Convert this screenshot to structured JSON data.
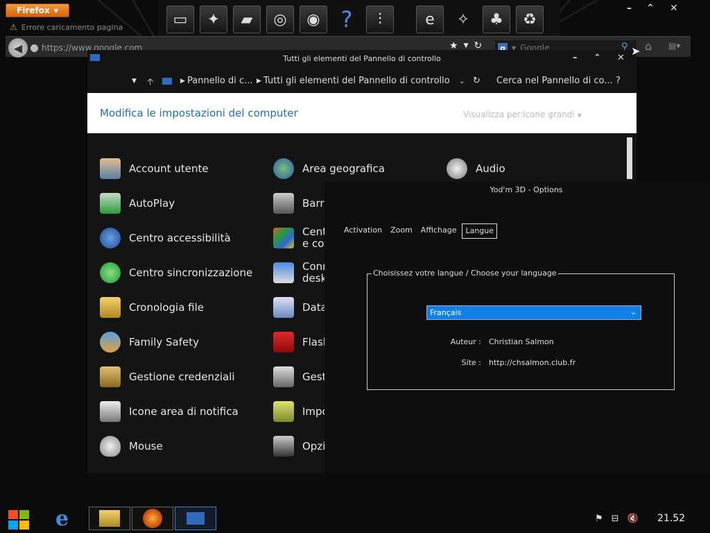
{
  "firefox": {
    "menu_label": "Firefox",
    "tab_title": "Errore caricamento pagina",
    "url": "https://www.google.com",
    "search_engine": "Google",
    "search_placeholder": "Google"
  },
  "control_panel": {
    "window_title": "Tutti gli elementi del Pannello di controllo",
    "breadcrumb": [
      "Pannello di c...",
      "Tutti gli elementi del Pannello di controllo"
    ],
    "search_placeholder": "Cerca nel Pannello di co...",
    "help": "?",
    "header_title": "Modifica le impostazioni del computer",
    "view_label": "Visualizza per:",
    "view_value": "Icone grandi",
    "items_col1": [
      "Account utente",
      "AutoPlay",
      "Centro accessibilità",
      "Centro sincronizzazione",
      "Cronologia file",
      "Family Safety",
      "Gestione credenziali",
      "Icone area di notifica",
      "Mouse"
    ],
    "items_col2": [
      "Area geografica",
      "Barr",
      "Cent\ne co",
      "Conr\ndesk",
      "Data",
      "Flasl",
      "Gest",
      "Impo",
      "Opzi"
    ],
    "items_col3": [
      "Audio"
    ]
  },
  "yodm": {
    "title": "Yod'm 3D - Options",
    "tabs": [
      "Activation",
      "Zoom",
      "Affichage",
      "Langue"
    ],
    "active_tab": "Langue",
    "group_title": "Choisissez votre langue / Choose your language",
    "language": "Français",
    "author_label": "Auteur :",
    "author_value": "Christian Salmon",
    "site_label": "Site :",
    "site_value": "http://chsalmon.club.fr"
  },
  "taskbar": {
    "clock": "21.52"
  },
  "colors": {
    "accent": "#1181e8",
    "header_link": "#1e6fb0",
    "firefox_orange": "#e8760f"
  }
}
